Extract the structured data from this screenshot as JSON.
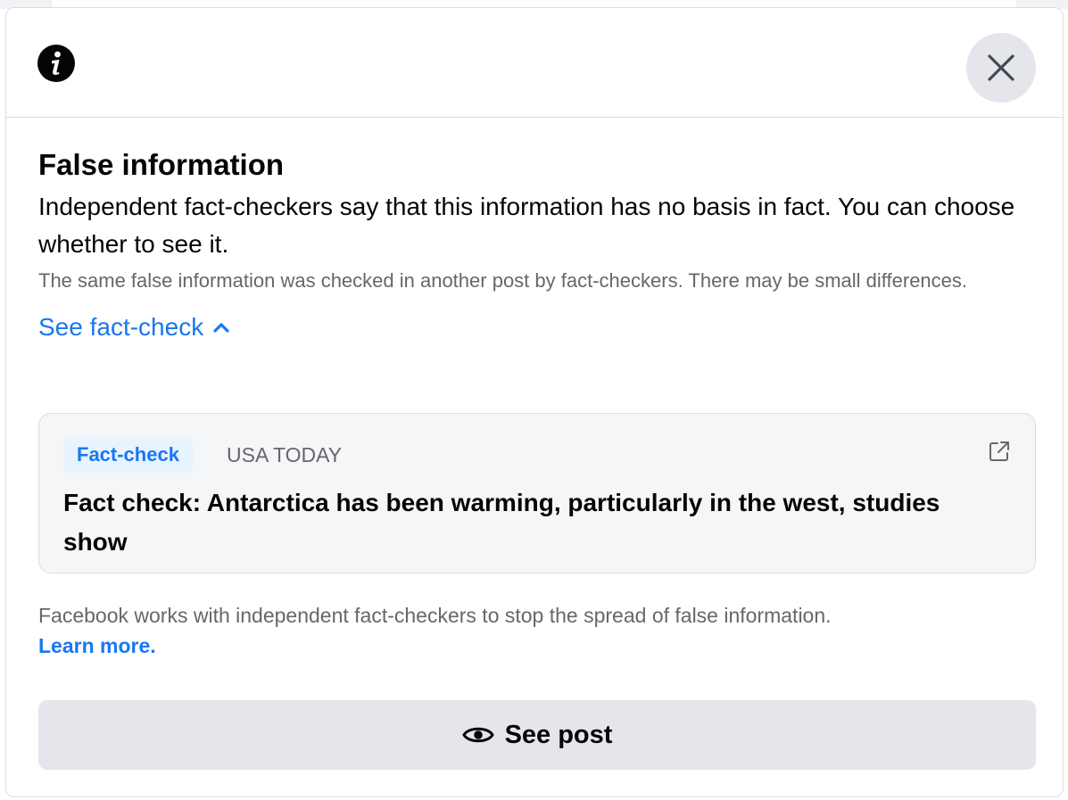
{
  "dialog": {
    "header": {
      "info_icon": "info-circle-icon",
      "close_icon": "close-icon"
    },
    "title": "False information",
    "description": "Independent fact-checkers say that this information has no basis in fact. You can choose whether to see it.",
    "sub_description": "The same false information was checked in another post by fact-checkers. There may be small differences.",
    "see_fact_check": {
      "label": "See fact-check",
      "icon": "chevron-up-icon"
    },
    "fact_check_card": {
      "badge": "Fact-check",
      "publisher": "USA TODAY",
      "headline": "Fact check: Antarctica has been warming, particularly in the west, studies show",
      "icon": "external-link-icon"
    },
    "footer": {
      "note": "Facebook works with independent fact-checkers to stop the spread of false information.",
      "learn_more": "Learn more."
    },
    "see_post_button": {
      "label": "See post",
      "icon": "eye-icon"
    }
  },
  "colors": {
    "accent": "#1877f2",
    "secondary_text": "#65676b",
    "button_bg": "#e4e6eb",
    "card_bg": "#f5f6f7",
    "border": "#dadde1"
  }
}
